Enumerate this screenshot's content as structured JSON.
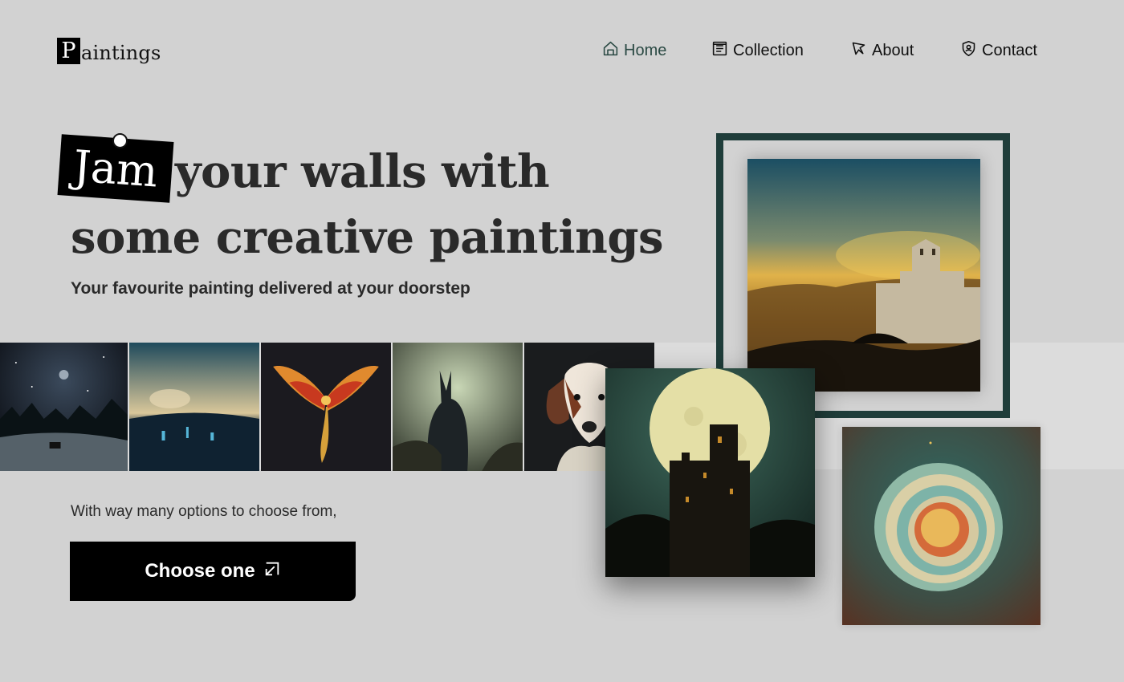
{
  "brand": {
    "logo_initial": "P",
    "logo_rest": "aintings"
  },
  "nav": {
    "items": [
      {
        "label": "Home",
        "icon": "home-icon",
        "active": true
      },
      {
        "label": "Collection",
        "icon": "collection-icon",
        "active": false
      },
      {
        "label": "About",
        "icon": "about-icon",
        "active": false
      },
      {
        "label": "Contact",
        "icon": "contact-icon",
        "active": false
      }
    ]
  },
  "hero": {
    "tag_word": "Jam",
    "line1_rest": "your walls with",
    "line2": "some creative paintings",
    "subtitle": "Your favourite painting delivered at your doorstep"
  },
  "strip": {
    "paintings": [
      {
        "name": "night-forest-painting"
      },
      {
        "name": "sky-city-painting"
      },
      {
        "name": "phoenix-painting"
      },
      {
        "name": "rabbit-figure-painting"
      },
      {
        "name": "dog-portrait-painting"
      }
    ]
  },
  "cta": {
    "options_text": "With way many options to choose from,",
    "button_label": "Choose one",
    "button_icon": "arrow-out-icon"
  },
  "gallery": {
    "framed": "castle-landscape-painting",
    "front": "moon-castle-painting",
    "side": "planet-rings-painting"
  },
  "colors": {
    "background": "#d2d2d2",
    "frame": "#1f3d3a",
    "nav_active": "#2b4a44",
    "button": "#000000"
  }
}
